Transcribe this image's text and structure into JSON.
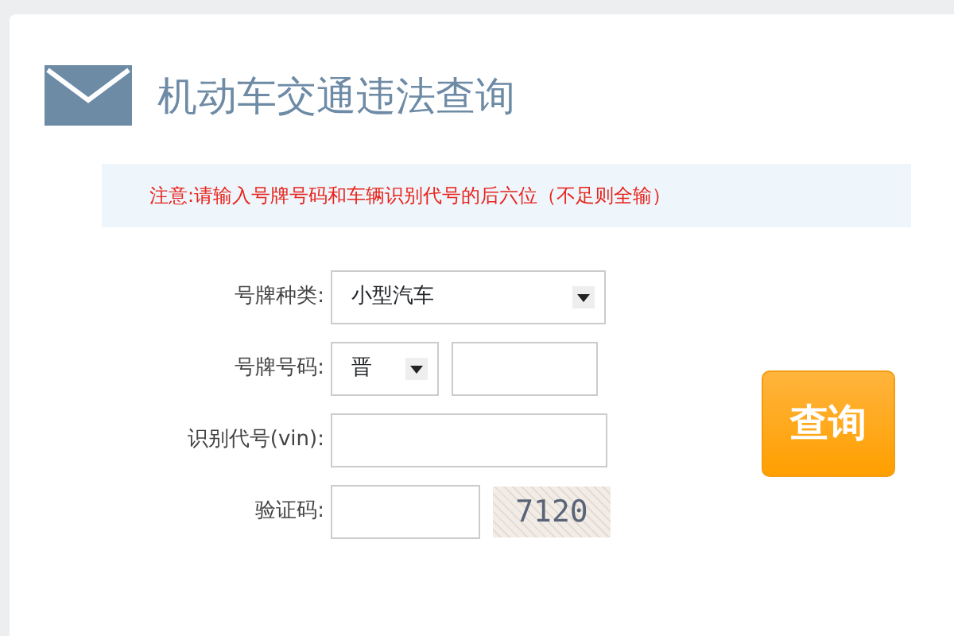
{
  "title": "机动车交通违法查询",
  "notice": "注意:请输入号牌号码和车辆识别代号的后六位（不足则全输）",
  "form": {
    "plate_type": {
      "label": "号牌种类:",
      "value": "小型汽车"
    },
    "plate_number": {
      "label": "号牌号码:",
      "prefix": "晋"
    },
    "vin": {
      "label": "识别代号(vin):"
    },
    "captcha": {
      "label": "验证码:",
      "code": "7120"
    }
  },
  "submit_button": "查询"
}
